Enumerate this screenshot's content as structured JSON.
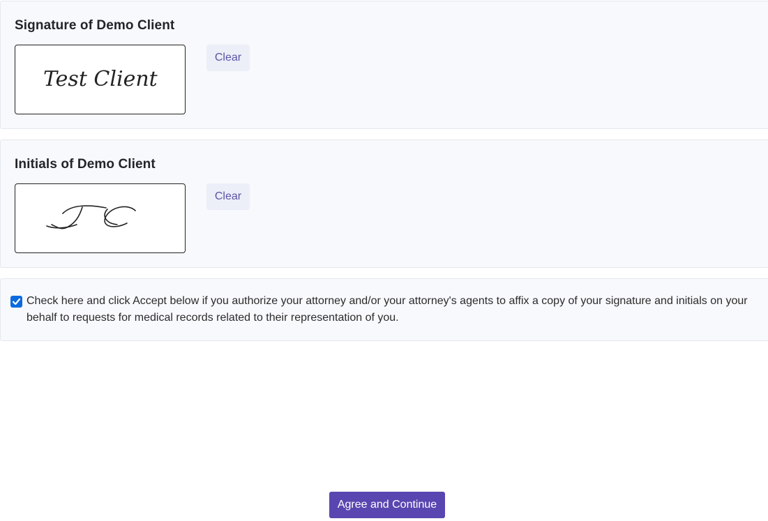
{
  "signature_section": {
    "title": "Signature of Demo Client",
    "signature_text": "Test Client",
    "clear_label": "Clear"
  },
  "initials_section": {
    "title": "Initials of Demo Client",
    "initials_text": "TC",
    "clear_label": "Clear"
  },
  "consent": {
    "checked": true,
    "text": "Check here and click Accept below if you authorize your attorney and/or your attorney's agents to affix a copy of your signature and initials on your behalf to requests for medical records related to their representation of you."
  },
  "actions": {
    "agree_label": "Agree and Continue"
  },
  "colors": {
    "primary": "#5a46b0",
    "checkbox": "#0b6bde",
    "clear_bg": "#eceef8",
    "clear_text": "#5a55a6"
  }
}
